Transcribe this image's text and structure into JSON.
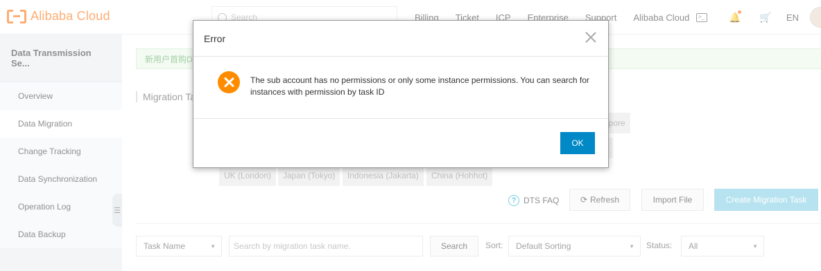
{
  "header": {
    "logo_text": "Alibaba Cloud",
    "search_placeholder": "Search",
    "nav": [
      "Billing",
      "Ticket",
      "ICP",
      "Enterprise",
      "Support",
      "Alibaba Cloud"
    ],
    "lang": "EN",
    "brand_color": "#ff6a00"
  },
  "sidebar": {
    "title": "Data Transmission Se...",
    "items": [
      {
        "label": "Overview"
      },
      {
        "label": "Data Migration"
      },
      {
        "label": "Change Tracking"
      },
      {
        "label": "Data Synchronization"
      },
      {
        "label": "Operation Log"
      },
      {
        "label": "Data Backup"
      }
    ]
  },
  "main": {
    "notice": "新用户首购D",
    "section_title": "Migration Ta",
    "regions_row1_partial": "apore",
    "regions_row3": [
      "UK (London)",
      "Japan (Tokyo)",
      "Indonesia (Jakarta)",
      "China (Hohhot)"
    ],
    "faq_label": "DTS FAQ",
    "refresh_label": "Refresh",
    "import_label": "Import File",
    "create_label": "Create Migration Task",
    "filter": {
      "field_select": "Task Name",
      "search_placeholder": "Search by migration task name.",
      "search_button": "Search",
      "sort_label": "Sort:",
      "sort_value": "Default Sorting",
      "status_label": "Status:",
      "status_value": "All"
    }
  },
  "dialog": {
    "title": "Error",
    "message": "The sub account has no permissions or only some instance permissions. You can search for instances with permission by task ID",
    "ok_label": "OK",
    "ok_color": "#0089c6",
    "icon_color": "#ff8c00"
  }
}
